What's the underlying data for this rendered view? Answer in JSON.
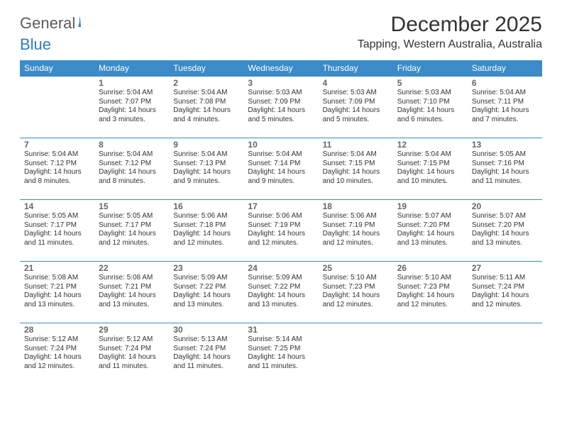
{
  "brand": {
    "part1": "General",
    "part2": "Blue"
  },
  "title": "December 2025",
  "location": "Tapping, Western Australia, Australia",
  "weekdays": [
    "Sunday",
    "Monday",
    "Tuesday",
    "Wednesday",
    "Thursday",
    "Friday",
    "Saturday"
  ],
  "chart_data": {
    "type": "table",
    "title": "December 2025 Sunrise/Sunset — Tapping, Western Australia, Australia",
    "columns": [
      "day",
      "sunrise",
      "sunset",
      "daylight"
    ],
    "rows": [
      {
        "day": 1,
        "sunrise": "5:04 AM",
        "sunset": "7:07 PM",
        "daylight": "14 hours and 3 minutes."
      },
      {
        "day": 2,
        "sunrise": "5:04 AM",
        "sunset": "7:08 PM",
        "daylight": "14 hours and 4 minutes."
      },
      {
        "day": 3,
        "sunrise": "5:03 AM",
        "sunset": "7:09 PM",
        "daylight": "14 hours and 5 minutes."
      },
      {
        "day": 4,
        "sunrise": "5:03 AM",
        "sunset": "7:09 PM",
        "daylight": "14 hours and 5 minutes."
      },
      {
        "day": 5,
        "sunrise": "5:03 AM",
        "sunset": "7:10 PM",
        "daylight": "14 hours and 6 minutes."
      },
      {
        "day": 6,
        "sunrise": "5:04 AM",
        "sunset": "7:11 PM",
        "daylight": "14 hours and 7 minutes."
      },
      {
        "day": 7,
        "sunrise": "5:04 AM",
        "sunset": "7:12 PM",
        "daylight": "14 hours and 8 minutes."
      },
      {
        "day": 8,
        "sunrise": "5:04 AM",
        "sunset": "7:12 PM",
        "daylight": "14 hours and 8 minutes."
      },
      {
        "day": 9,
        "sunrise": "5:04 AM",
        "sunset": "7:13 PM",
        "daylight": "14 hours and 9 minutes."
      },
      {
        "day": 10,
        "sunrise": "5:04 AM",
        "sunset": "7:14 PM",
        "daylight": "14 hours and 9 minutes."
      },
      {
        "day": 11,
        "sunrise": "5:04 AM",
        "sunset": "7:15 PM",
        "daylight": "14 hours and 10 minutes."
      },
      {
        "day": 12,
        "sunrise": "5:04 AM",
        "sunset": "7:15 PM",
        "daylight": "14 hours and 10 minutes."
      },
      {
        "day": 13,
        "sunrise": "5:05 AM",
        "sunset": "7:16 PM",
        "daylight": "14 hours and 11 minutes."
      },
      {
        "day": 14,
        "sunrise": "5:05 AM",
        "sunset": "7:17 PM",
        "daylight": "14 hours and 11 minutes."
      },
      {
        "day": 15,
        "sunrise": "5:05 AM",
        "sunset": "7:17 PM",
        "daylight": "14 hours and 12 minutes."
      },
      {
        "day": 16,
        "sunrise": "5:06 AM",
        "sunset": "7:18 PM",
        "daylight": "14 hours and 12 minutes."
      },
      {
        "day": 17,
        "sunrise": "5:06 AM",
        "sunset": "7:19 PM",
        "daylight": "14 hours and 12 minutes."
      },
      {
        "day": 18,
        "sunrise": "5:06 AM",
        "sunset": "7:19 PM",
        "daylight": "14 hours and 12 minutes."
      },
      {
        "day": 19,
        "sunrise": "5:07 AM",
        "sunset": "7:20 PM",
        "daylight": "14 hours and 13 minutes."
      },
      {
        "day": 20,
        "sunrise": "5:07 AM",
        "sunset": "7:20 PM",
        "daylight": "14 hours and 13 minutes."
      },
      {
        "day": 21,
        "sunrise": "5:08 AM",
        "sunset": "7:21 PM",
        "daylight": "14 hours and 13 minutes."
      },
      {
        "day": 22,
        "sunrise": "5:08 AM",
        "sunset": "7:21 PM",
        "daylight": "14 hours and 13 minutes."
      },
      {
        "day": 23,
        "sunrise": "5:09 AM",
        "sunset": "7:22 PM",
        "daylight": "14 hours and 13 minutes."
      },
      {
        "day": 24,
        "sunrise": "5:09 AM",
        "sunset": "7:22 PM",
        "daylight": "14 hours and 13 minutes."
      },
      {
        "day": 25,
        "sunrise": "5:10 AM",
        "sunset": "7:23 PM",
        "daylight": "14 hours and 12 minutes."
      },
      {
        "day": 26,
        "sunrise": "5:10 AM",
        "sunset": "7:23 PM",
        "daylight": "14 hours and 12 minutes."
      },
      {
        "day": 27,
        "sunrise": "5:11 AM",
        "sunset": "7:24 PM",
        "daylight": "14 hours and 12 minutes."
      },
      {
        "day": 28,
        "sunrise": "5:12 AM",
        "sunset": "7:24 PM",
        "daylight": "14 hours and 12 minutes."
      },
      {
        "day": 29,
        "sunrise": "5:12 AM",
        "sunset": "7:24 PM",
        "daylight": "14 hours and 11 minutes."
      },
      {
        "day": 30,
        "sunrise": "5:13 AM",
        "sunset": "7:24 PM",
        "daylight": "14 hours and 11 minutes."
      },
      {
        "day": 31,
        "sunrise": "5:14 AM",
        "sunset": "7:25 PM",
        "daylight": "14 hours and 11 minutes."
      }
    ]
  },
  "labels": {
    "sunrise": "Sunrise: ",
    "sunset": "Sunset: ",
    "daylight": "Daylight: "
  },
  "start_weekday": 1
}
